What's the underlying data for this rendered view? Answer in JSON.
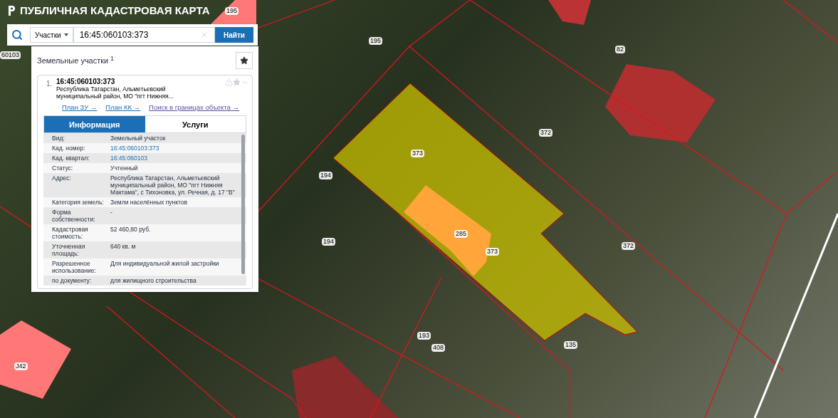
{
  "header": {
    "title": "ПУБЛИЧНАЯ КАДАСТРОВАЯ КАРТА"
  },
  "search": {
    "category": "Участки",
    "value": "16:45:060103:373",
    "button": "Найти"
  },
  "results": {
    "heading": "Земельные участки $^{1}$",
    "items": [
      {
        "number": "1.",
        "title": "16:45:060103:373",
        "address": "Республика Татарстан, Альметьевский муниципальный район, МО \"пгт Нижняя...",
        "expanded": true,
        "links": [
          "План ЗУ →",
          "План КК →",
          "Поиск в границах объекта →"
        ],
        "tabs": [
          {
            "label": "Информация",
            "selected": true
          },
          {
            "label": "Услуги",
            "selected": false
          }
        ],
        "rows": [
          {
            "key": "Вид:",
            "value": "Земельный участок",
            "kind": "text"
          },
          {
            "key": "Кад. номер:",
            "value": "16:45:060103:373",
            "kind": "link"
          },
          {
            "key": "Кад. квартал:",
            "value": "16:45:060103",
            "kind": "link"
          },
          {
            "key": "Статус:",
            "value": "Учтенный",
            "kind": "text"
          },
          {
            "key": "Адрес:",
            "value": "Республика Татарстан, Альметьевский муниципальный район, МО \"пгт Нижняя Мактама\", с Тихоновка, ул. Речная, д. 17 \"В\"",
            "kind": "text"
          },
          {
            "key": "Категория земель:",
            "value": "Земли населённых пунктов",
            "kind": "text"
          },
          {
            "key": "Форма собственности:",
            "value": "-",
            "kind": "text"
          },
          {
            "key": "Кадастровая стоимость:",
            "value": "52 460,80 руб.",
            "kind": "text"
          },
          {
            "key": "Уточненная площадь:",
            "value": "640 кв. м",
            "kind": "text"
          },
          {
            "key": "Разрешенное использование:",
            "value": "Для индивидуальной жилой застройки",
            "kind": "text"
          },
          {
            "key": "по документу:",
            "value": "для жилищного строительства",
            "kind": "text"
          }
        ]
      }
    ]
  },
  "map": {
    "labels": [
      "195",
      "195",
      "60103",
      "82",
      "372",
      "373",
      "194",
      "194",
      "285",
      "373",
      "372",
      "193",
      "408",
      "135",
      "J42"
    ]
  }
}
